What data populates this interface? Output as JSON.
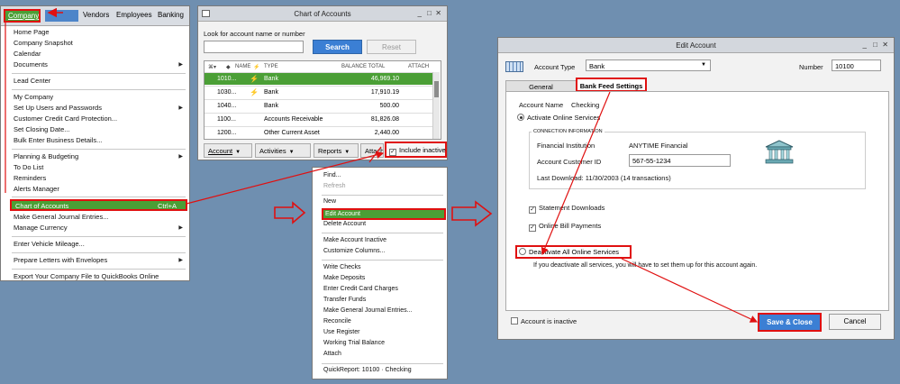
{
  "company_menu": {
    "menubar": {
      "company": "Company",
      "vendors": "Vendors",
      "employees": "Employees",
      "banking": "Banking"
    },
    "items": [
      {
        "label": "Home Page"
      },
      {
        "label": "Company Snapshot"
      },
      {
        "label": "Calendar"
      },
      {
        "label": "Documents"
      },
      {
        "label": "Lead Center"
      },
      {
        "label": "My Company"
      },
      {
        "label": "Set Up Users and Passwords"
      },
      {
        "label": "Customer Credit Card Protection..."
      },
      {
        "label": "Set Closing Date..."
      },
      {
        "label": "Bulk Enter Business Details..."
      },
      {
        "label": "Planning & Budgeting"
      },
      {
        "label": "To Do List"
      },
      {
        "label": "Reminders"
      },
      {
        "label": "Alerts Manager"
      },
      {
        "label": "Make General Journal Entries..."
      },
      {
        "label": "Manage Currency"
      },
      {
        "label": "Enter Vehicle Mileage..."
      },
      {
        "label": "Prepare Letters with Envelopes"
      },
      {
        "label": "Export Your Company File to QuickBooks Online"
      }
    ],
    "chart_of_accounts": {
      "label": "Chart of Accounts",
      "shortcut": "Ctrl+A"
    }
  },
  "coa_window": {
    "title": "Chart of Accounts",
    "search_label": "Look for account name or number",
    "search_button": "Search",
    "reset_button": "Reset",
    "columns": {
      "name": "NAME",
      "type": "TYPE",
      "balance": "BALANCE TOTAL",
      "attach": "ATTACH"
    },
    "rows": [
      {
        "number": "1010...",
        "type": "Bank",
        "balance": "46,969.10"
      },
      {
        "number": "1030...",
        "type": "Bank",
        "balance": "17,910.19"
      },
      {
        "number": "1040...",
        "type": "Bank",
        "balance": "500.00"
      },
      {
        "number": "1100...",
        "type": "Accounts Receivable",
        "balance": "81,826.08"
      },
      {
        "number": "1200...",
        "type": "Other Current Asset",
        "balance": "2,440.00"
      }
    ],
    "footer": {
      "account": "Account",
      "activities": "Activities",
      "reports": "Reports",
      "attach": "Attach",
      "include_inactive": "Include inactive"
    }
  },
  "account_menu": {
    "items": [
      {
        "label": "Find...",
        "enabled": true
      },
      {
        "label": "Refresh",
        "enabled": false
      },
      {
        "label": "New",
        "enabled": true
      },
      {
        "label": "Edit Account",
        "enabled": true
      },
      {
        "label": "Delete Account",
        "enabled": true
      },
      {
        "label": "Make Account Inactive",
        "enabled": true
      },
      {
        "label": "Customize Columns...",
        "enabled": true
      },
      {
        "label": "Write Checks",
        "enabled": true
      },
      {
        "label": "Make Deposits",
        "enabled": true
      },
      {
        "label": "Enter Credit Card Charges",
        "enabled": true
      },
      {
        "label": "Transfer Funds",
        "enabled": true
      },
      {
        "label": "Make General Journal Entries...",
        "enabled": true
      },
      {
        "label": "Reconcile",
        "enabled": true
      },
      {
        "label": "Use Register",
        "enabled": true
      },
      {
        "label": "Working Trial Balance",
        "enabled": true
      },
      {
        "label": "Attach",
        "enabled": true
      },
      {
        "label": "QuickReport: 10100 · Checking",
        "enabled": true
      }
    ]
  },
  "edit_account": {
    "title": "Edit Account",
    "account_type_label": "Account Type",
    "account_type_value": "Bank",
    "number_label": "Number",
    "number_value": "10100",
    "tabs": {
      "general": "General",
      "bank_feed": "Bank Feed Settings"
    },
    "account_name_label": "Account Name",
    "account_name_value": "Checking",
    "activate_label": "Activate Online Services",
    "connection_header": "CONNECTION INFORMATION",
    "fin_inst_label": "Financial Institution",
    "fin_inst_value": "ANYTIME Financial",
    "customer_id_label": "Account Customer ID",
    "customer_id_value": "567-55-1234",
    "last_download": "Last Download: 11/30/2003 (14 transactions)",
    "statement_downloads": "Statement Downloads",
    "online_bill_payments": "Online Bill Payments",
    "deactivate_label": "Deactivate All Online Services",
    "deactivate_note": "If you deactivate all services, you will have to set them up for this account again.",
    "inactive_label": "Account is inactive",
    "save_close": "Save & Close",
    "cancel": "Cancel"
  }
}
